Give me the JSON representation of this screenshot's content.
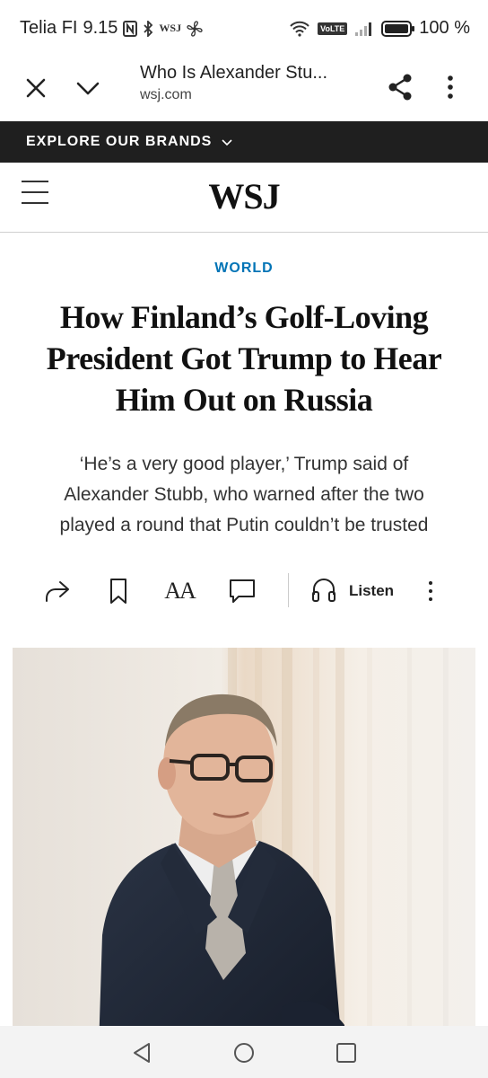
{
  "status_bar": {
    "carrier": "Telia FI",
    "time": "9.15",
    "icons": [
      "nfc-icon",
      "bluetooth-icon",
      "wsj-notification-icon",
      "fan-icon"
    ],
    "network_badge": "VoLTE",
    "battery": "100 %",
    "battery_level": 1.0
  },
  "custom_tab": {
    "title": "Who Is Alexander Stu...",
    "url": "wsj.com"
  },
  "brands_bar": {
    "label": "EXPLORE OUR BRANDS"
  },
  "header": {
    "logo": "WSJ"
  },
  "article": {
    "section": "WORLD",
    "headline": "How Finland’s Golf-Loving President Got Trump to Hear Him Out on Russia",
    "dek": "‘He’s a very good player,’ Trump said of Alexander Stubb, who warned after the two played a round that Putin couldn’t be trusted"
  },
  "tools": {
    "listen_label": "Listen",
    "font_size_label": "AA"
  },
  "colors": {
    "section_accent": "#0274b6",
    "brands_bar_bg": "#1f1f1f"
  }
}
